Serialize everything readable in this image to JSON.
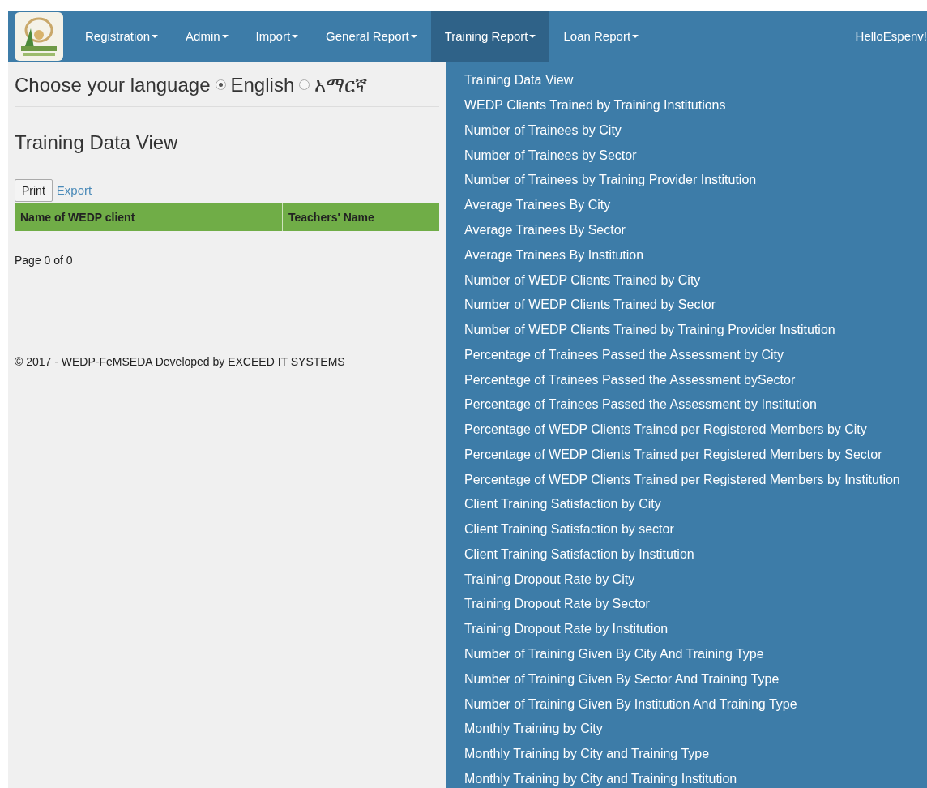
{
  "navbar": {
    "items": [
      {
        "label": "Registration",
        "selected": false
      },
      {
        "label": "Admin",
        "selected": false
      },
      {
        "label": "Import",
        "selected": false
      },
      {
        "label": "General Report",
        "selected": false
      },
      {
        "label": "Training Report",
        "selected": true
      },
      {
        "label": "Loan Report",
        "selected": false
      }
    ],
    "greeting": "HelloEspenv!"
  },
  "language": {
    "label": "Choose your language",
    "options": [
      {
        "label": "English",
        "selected": true
      },
      {
        "label": "አማርኛ",
        "selected": false
      }
    ]
  },
  "page_title": "Training Data View",
  "buttons": {
    "print": "Print",
    "export": "Export"
  },
  "table": {
    "columns": [
      "Name of WEDP client",
      "Teachers' Name"
    ]
  },
  "pagination": "Page 0 of 0",
  "footer": "© 2017 - WEDP-FeMSEDA Developed by EXCEED IT SYSTEMS",
  "dropdown": {
    "items": [
      "Training Data View",
      "WEDP Clients Trained by Training Institutions",
      "Number of Trainees by City",
      "Number of Trainees by Sector",
      "Number of Trainees by Training Provider Institution",
      "Average Trainees By City",
      "Average Trainees By Sector",
      "Average Trainees By Institution",
      "Number of WEDP Clients Trained by City",
      "Number of WEDP Clients Trained by Sector",
      "Number of WEDP Clients Trained by Training Provider Institution",
      "Percentage of Trainees Passed the Assessment by City",
      "Percentage of Trainees Passed the Assessment bySector",
      "Percentage of Trainees Passed the Assessment by Institution",
      "Percentage of WEDP Clients Trained per Registered Members by City",
      "Percentage of WEDP Clients Trained per Registered Members by Sector",
      "Percentage of WEDP Clients Trained per Registered Members by Institution",
      "Client Training Satisfaction by City",
      "Client Training Satisfaction by sector",
      "Client Training Satisfaction by Institution",
      "Training Dropout Rate by City",
      "Training Dropout Rate by Sector",
      "Training Dropout Rate by Institution",
      "Number of Training Given By City And Training Type",
      "Number of Training Given By Sector And Training Type",
      "Number of Training Given By Institution And Training Type",
      "Monthly Training by City",
      "Monthly Training by City and Training Type",
      "Monthly Training by City and Training Institution"
    ]
  }
}
